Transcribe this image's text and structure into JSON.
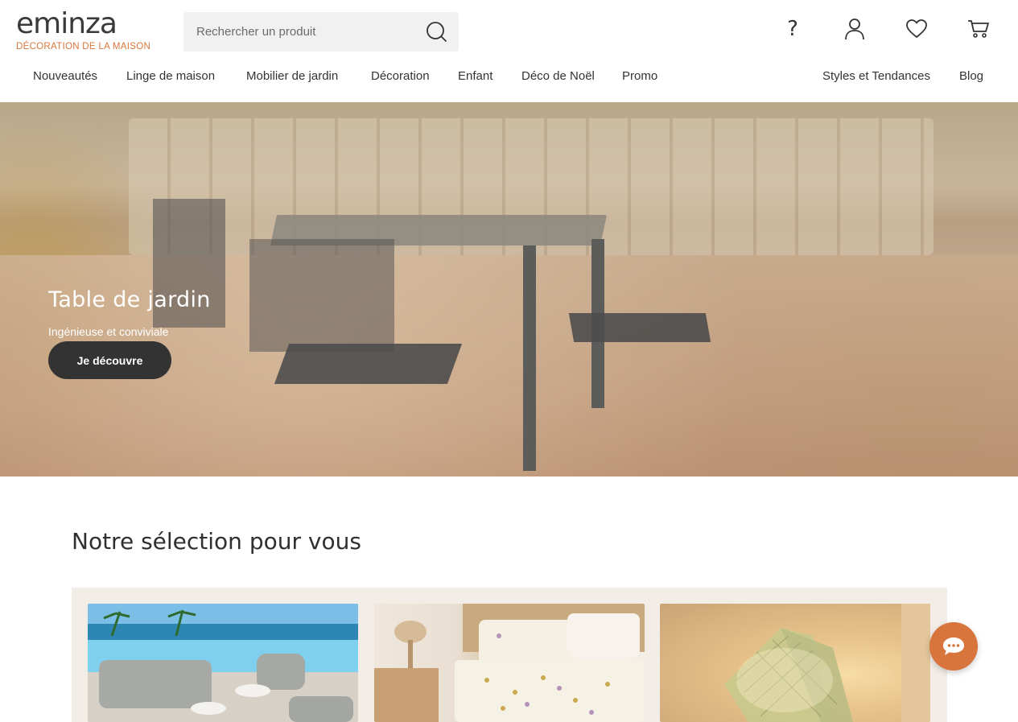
{
  "brand": {
    "name": "eminza",
    "tagline": "DÉCORATION DE LA MAISON",
    "accent_color": "#d8763b"
  },
  "search": {
    "placeholder": "Rechercher un produit",
    "value": ""
  },
  "header_icons": [
    "help-icon",
    "account-icon",
    "wishlist-icon",
    "cart-icon"
  ],
  "help": {
    "glyph": "?"
  },
  "nav": {
    "left": [
      {
        "label": "Nouveautés"
      },
      {
        "label": "Linge de maison"
      },
      {
        "label": "Mobilier de jardin"
      },
      {
        "label": "Décoration"
      },
      {
        "label": "Enfant"
      },
      {
        "label": "Déco de Noël"
      },
      {
        "label": "Promo"
      }
    ],
    "right": [
      {
        "label": "Styles et Tendances"
      },
      {
        "label": "Blog"
      }
    ]
  },
  "hero": {
    "title": "Table de jardin",
    "subtitle": "Ingénieuse et conviviale",
    "cta_label": "Je découvre"
  },
  "selection": {
    "title": "Notre sélection pour vous",
    "background_color": "#f3ede8"
  },
  "chat": {
    "color": "#d8753d",
    "icon": "chat-bubble-icon"
  }
}
